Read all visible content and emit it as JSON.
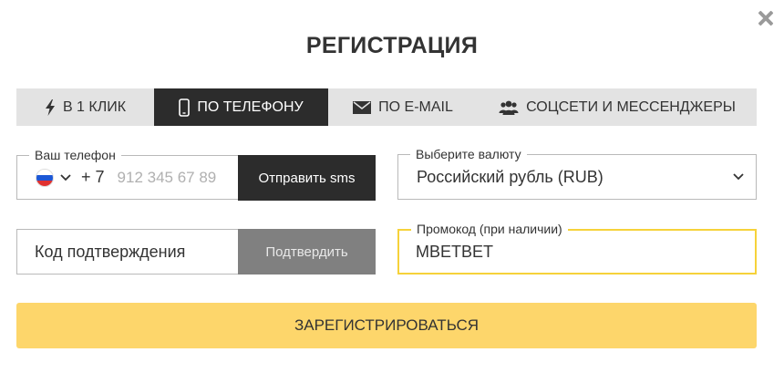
{
  "modal": {
    "title": "РЕГИСТРАЦИЯ"
  },
  "tabs": [
    {
      "label": "В 1 КЛИК",
      "icon": "lightning-icon",
      "active": false
    },
    {
      "label": "ПО ТЕЛЕФОНУ",
      "icon": "phone-icon",
      "active": true
    },
    {
      "label": "ПО E-MAIL",
      "icon": "envelope-icon",
      "active": false
    },
    {
      "label": "СОЦСЕТИ И МЕССЕНДЖЕРЫ",
      "icon": "users-icon",
      "active": false
    }
  ],
  "phone": {
    "legend": "Ваш телефон",
    "country_flag": "russia-flag-icon",
    "prefix": "+ 7",
    "placeholder": "912 345 67 89",
    "value": "",
    "send_button": "Отправить sms"
  },
  "currency": {
    "legend": "Выберите валюту",
    "selected": "Российский рубль (RUB)"
  },
  "confirmation": {
    "placeholder": "Код подтверждения",
    "value": "",
    "confirm_button": "Подтвердить"
  },
  "promo": {
    "legend": "Промокод (при наличии)",
    "value": "MBETBET"
  },
  "register_button": "ЗАРЕГИСТРИРОВАТЬСЯ",
  "colors": {
    "accent": "#fdd66b",
    "promo_border": "#f6d23a",
    "active_tab": "#2c2c2c",
    "tab_bg": "#e3e3e3",
    "disabled_button": "#808080"
  }
}
